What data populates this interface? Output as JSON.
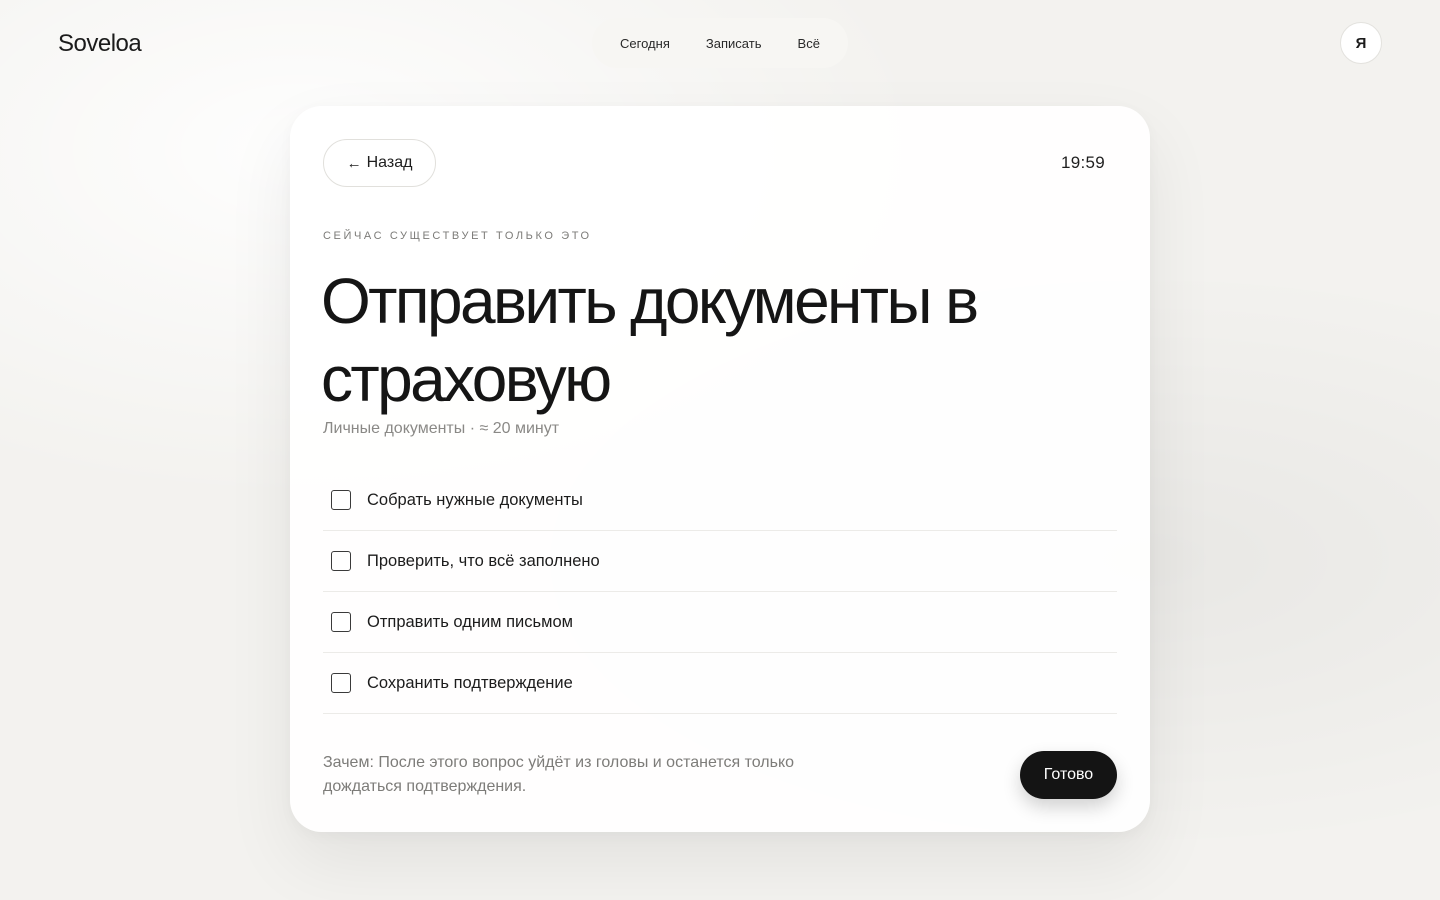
{
  "brand": {
    "name": "Soveloa"
  },
  "nav": {
    "items": [
      {
        "label": "Сегодня"
      },
      {
        "label": "Записать"
      },
      {
        "label": "Всё"
      }
    ]
  },
  "user": {
    "avatar_letter": "Я"
  },
  "task": {
    "back_label": "Назад",
    "back_icon": "arrow-left-icon",
    "timer": "19:59",
    "eyebrow": "СЕЙЧАС СУЩЕСТВУЕТ ТОЛЬКО ЭТО",
    "title": "Отправить документы в страховую",
    "meta": "Личные документы · ≈ 20 минут",
    "steps": [
      {
        "label": "Собрать нужные документы",
        "checked": false
      },
      {
        "label": "Проверить, что всё заполнено",
        "checked": false
      },
      {
        "label": "Отправить одним письмом",
        "checked": false
      },
      {
        "label": "Сохранить подтверждение",
        "checked": false
      }
    ],
    "why": "Зачем: После этого вопрос уйдёт из головы и останется только дождаться подтверждения.",
    "done_label": "Готово"
  }
}
